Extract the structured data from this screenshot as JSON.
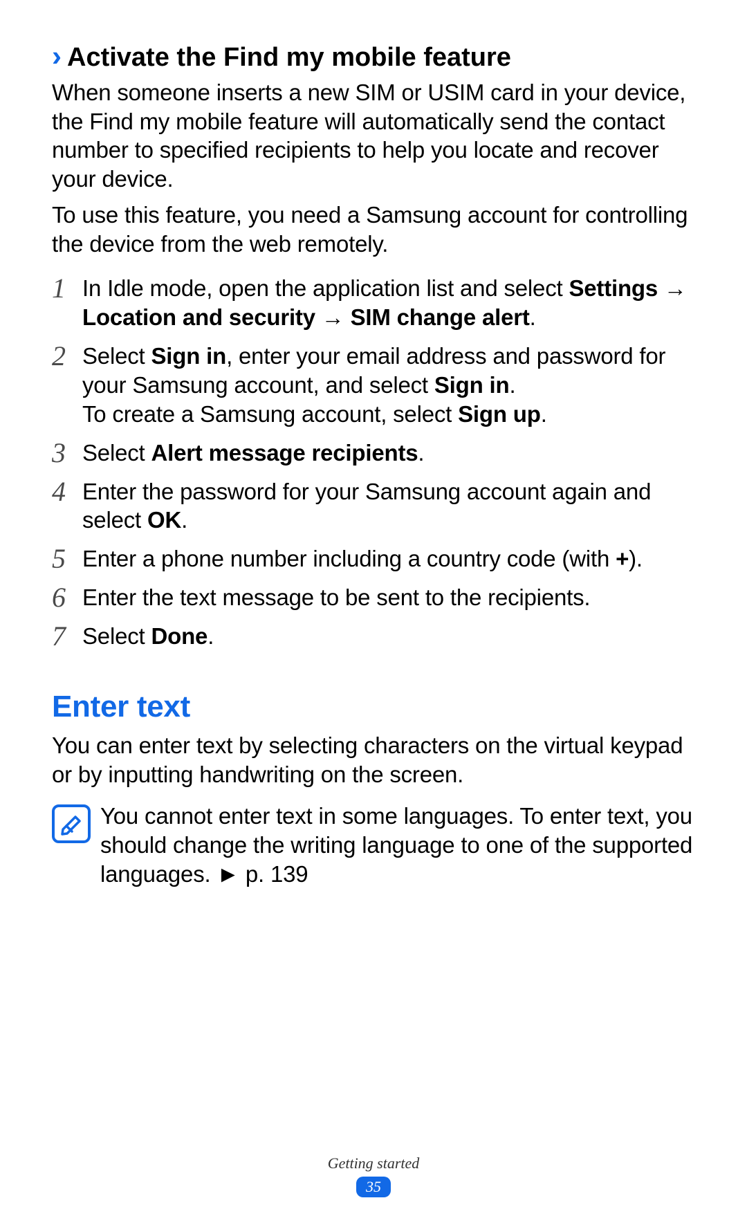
{
  "section1": {
    "chevron": "›",
    "title": "Activate the Find my mobile feature",
    "para1": "When someone inserts a new SIM or USIM card in your device, the Find my mobile feature will automatically send the contact number to specified recipients to help you locate and recover your device.",
    "para2": "To use this feature, you need a Samsung account for controlling the device from the web remotely."
  },
  "steps": {
    "s1": {
      "num": "1",
      "t1": "In Idle mode, open the application list and select ",
      "b1": "Settings → Location and security → SIM change alert",
      "t2": "."
    },
    "s2": {
      "num": "2",
      "t1": "Select ",
      "b1": "Sign in",
      "t2": ", enter your email address and password for your Samsung account, and select ",
      "b2": "Sign in",
      "t3": ".",
      "line2a": "To create a Samsung account, select ",
      "line2b": "Sign up",
      "line2c": "."
    },
    "s3": {
      "num": "3",
      "t1": "Select ",
      "b1": "Alert message recipients",
      "t2": "."
    },
    "s4": {
      "num": "4",
      "t1": "Enter the password for your Samsung account again and select ",
      "b1": "OK",
      "t2": "."
    },
    "s5": {
      "num": "5",
      "t1": "Enter a phone number including a country code (with ",
      "b1": "+",
      "t2": ")."
    },
    "s6": {
      "num": "6",
      "t1": "Enter the text message to be sent to the recipients."
    },
    "s7": {
      "num": "7",
      "t1": "Select ",
      "b1": "Done",
      "t2": "."
    }
  },
  "section2": {
    "title": "Enter text",
    "para": "You can enter text by selecting characters on the virtual keypad or by inputting handwriting on the screen.",
    "note": "You cannot enter text in some languages. To enter text, you should change the writing language to one of the supported languages. ► p. 139"
  },
  "footer": {
    "label": "Getting started",
    "page": "35"
  }
}
